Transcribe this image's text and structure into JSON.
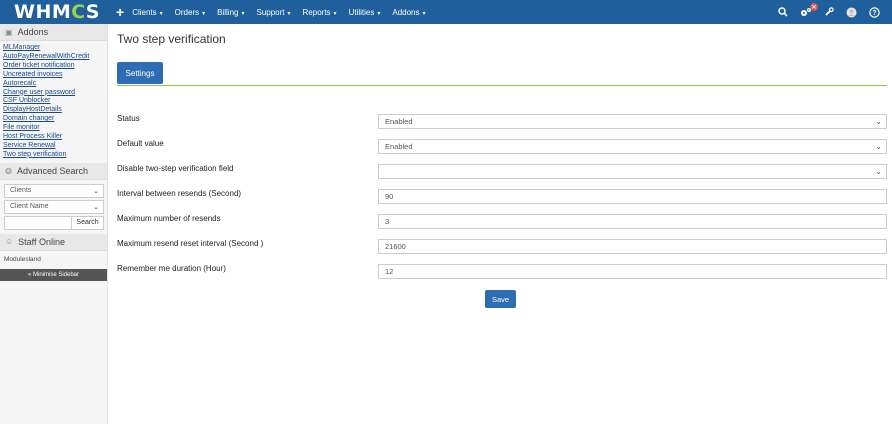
{
  "brand": {
    "logo_pre": "WHM",
    "logo_accent": "C",
    "logo_post": "S",
    "accent_color": "#8dc63f",
    "nav_color": "#1f5f9b"
  },
  "nav": {
    "items": [
      {
        "label": "Clients"
      },
      {
        "label": "Orders"
      },
      {
        "label": "Billing"
      },
      {
        "label": "Support"
      },
      {
        "label": "Reports"
      },
      {
        "label": "Utilities"
      },
      {
        "label": "Addons"
      }
    ],
    "right_icons": [
      "search-icon",
      "cogs-icon",
      "wrench-icon",
      "user-avatar-icon",
      "help-icon"
    ],
    "alert_badge": "✕"
  },
  "sidebar": {
    "addons_title": "Addons",
    "addons": [
      "MLManager",
      "AutoPayRenewalWithCredit",
      "Order ticket notification",
      "Uncreated invoices",
      "Autorecalc",
      "Change user password",
      "CSF Unblocker",
      "DisplayHostDetails",
      "Domain changer",
      "File monitor",
      "Host Process Killer",
      "Service Renewal",
      "Two step verification"
    ],
    "advanced_search_title": "Advanced Search",
    "search_type": "Clients",
    "search_field": "Client Name",
    "search_button": "Search",
    "staff_title": "Staff Online",
    "staff_name": "Modulesland",
    "minimise_label": "« Minimise Sidebar"
  },
  "main": {
    "title": "Two step verification",
    "tab_settings": "Settings",
    "fields": [
      {
        "label": "Status",
        "value": "Enabled",
        "type": "select"
      },
      {
        "label": "Default value",
        "value": "Enabled",
        "type": "select"
      },
      {
        "label": "Disable two-step verification field",
        "value": "",
        "type": "select"
      },
      {
        "label": "Interval between resends (Second)",
        "value": "90",
        "type": "input"
      },
      {
        "label": "Maximum number of resends",
        "value": "3",
        "type": "input"
      },
      {
        "label": "Maximum resend reset interval (Second )",
        "value": "21600",
        "type": "input"
      },
      {
        "label": "Remember me duration (Hour)",
        "value": "12",
        "type": "input"
      }
    ],
    "save_label": "Save"
  }
}
